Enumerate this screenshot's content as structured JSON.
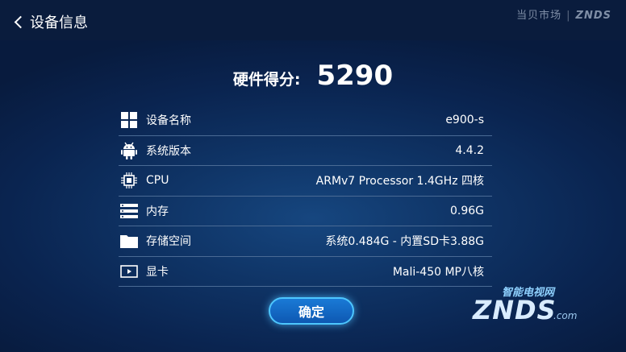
{
  "header": {
    "title": "设备信息",
    "brand": "当贝市场",
    "brand_sub": "ZNDS"
  },
  "score": {
    "label": "硬件得分:",
    "value": "5290"
  },
  "rows": [
    {
      "icon": "windows-tiles-icon",
      "label": "设备名称",
      "value": "e900-s"
    },
    {
      "icon": "android-icon",
      "label": "系统版本",
      "value": "4.4.2"
    },
    {
      "icon": "cpu-chip-icon",
      "label": "CPU",
      "value": "ARMv7 Processor 1.4GHz 四核"
    },
    {
      "icon": "memory-stack-icon",
      "label": "内存",
      "value": "0.96G"
    },
    {
      "icon": "folder-icon",
      "label": "存储空间",
      "value": "系统0.484G - 内置SD卡3.88G"
    },
    {
      "icon": "video-play-icon",
      "label": "显卡",
      "value": "Mali-450 MP八核"
    }
  ],
  "ok_button": "确定",
  "watermark": {
    "cn": "智能电视网",
    "en": "ZNDS",
    "domain": ".com"
  }
}
